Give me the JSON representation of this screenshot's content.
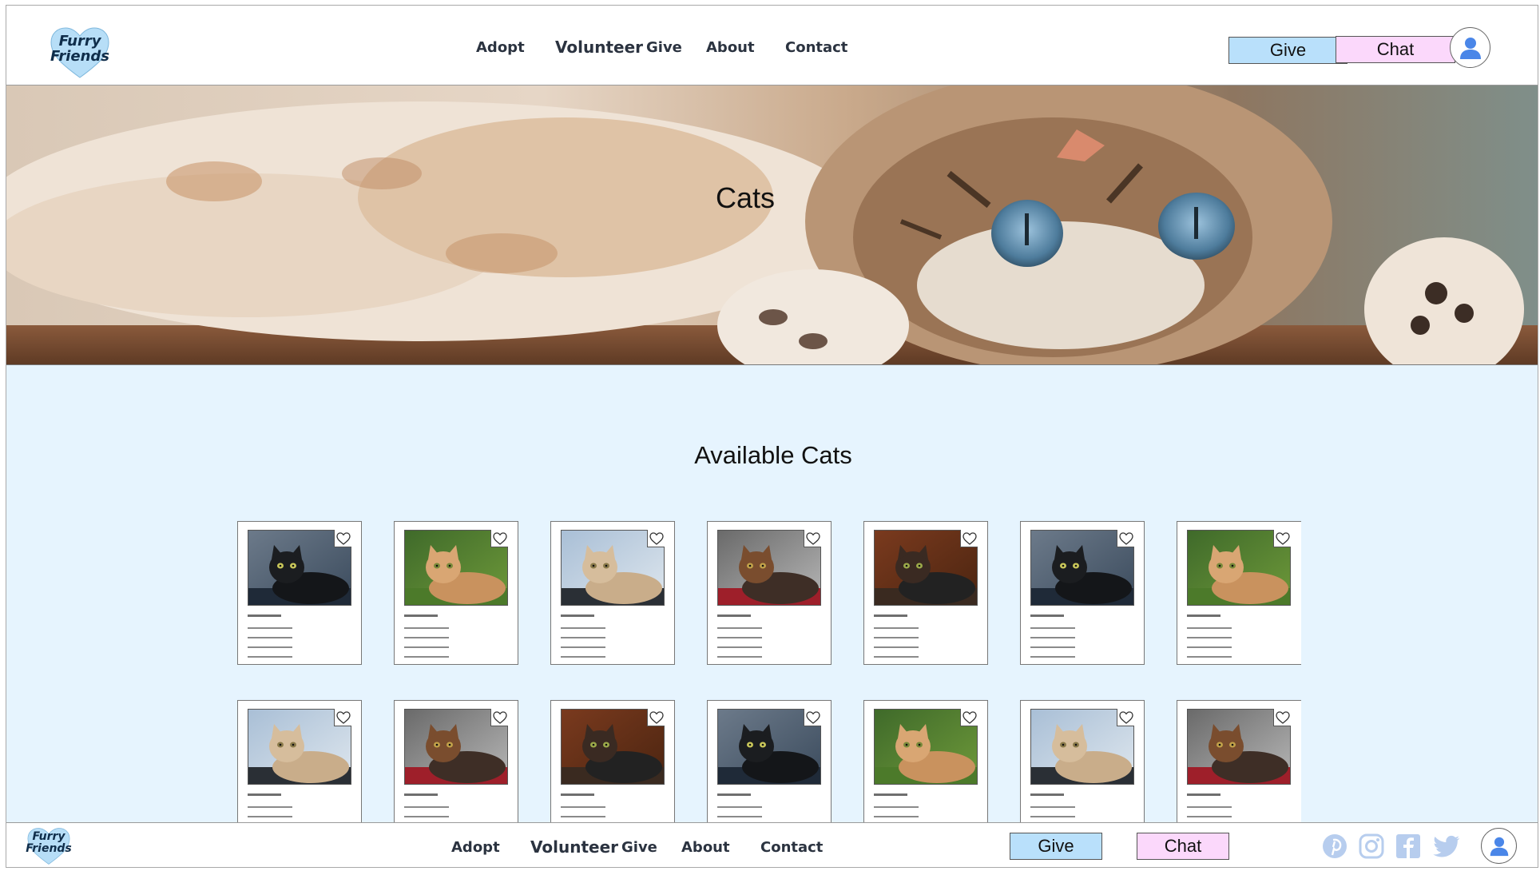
{
  "header": {
    "logo_line1": "Furry",
    "logo_line2": "Friends",
    "nav": [
      "Adopt",
      "Volunteer",
      "Give",
      "About",
      "Contact"
    ],
    "give_label": "Give",
    "chat_label": "Chat",
    "avatar_icon": "user-icon"
  },
  "hero": {
    "title": "Cats",
    "image": "cat-lying-upside-down-photo"
  },
  "main": {
    "section_title": "Available Cats",
    "cards_row1": [
      {
        "cat": "black",
        "favorite_icon": "heart-outline-icon"
      },
      {
        "cat": "ginger",
        "favorite_icon": "heart-outline-icon"
      },
      {
        "cat": "cream-outdoor",
        "favorite_icon": "heart-outline-icon"
      },
      {
        "cat": "tortoiseshell",
        "favorite_icon": "heart-outline-icon"
      },
      {
        "cat": "calico-dark",
        "favorite_icon": "heart-outline-icon"
      },
      {
        "cat": "black",
        "favorite_icon": "heart-outline-icon"
      },
      {
        "cat": "ginger",
        "favorite_icon": "heart-outline-icon"
      }
    ],
    "cards_row2": [
      {
        "cat": "cream-outdoor",
        "favorite_icon": "heart-outline-icon"
      },
      {
        "cat": "tortoiseshell",
        "favorite_icon": "heart-outline-icon"
      },
      {
        "cat": "calico-dark",
        "favorite_icon": "heart-outline-icon"
      },
      {
        "cat": "black",
        "favorite_icon": "heart-outline-icon"
      },
      {
        "cat": "ginger",
        "favorite_icon": "heart-outline-icon"
      },
      {
        "cat": "cream-outdoor",
        "favorite_icon": "heart-outline-icon"
      },
      {
        "cat": "tortoiseshell",
        "favorite_icon": "heart-outline-icon"
      }
    ]
  },
  "footer": {
    "logo_line1": "Furry",
    "logo_line2": "Friends",
    "nav": [
      "Adopt",
      "Volunteer",
      "Give",
      "About",
      "Contact"
    ],
    "give_label": "Give",
    "chat_label": "Chat",
    "social_icons": [
      "pinterest-icon",
      "instagram-icon",
      "facebook-icon",
      "twitter-icon"
    ],
    "avatar_icon": "user-icon"
  },
  "colors": {
    "main_bg": "#e6f4fe",
    "give_bg": "#b9e0fb",
    "chat_bg": "#fbd8fb",
    "accent_blue": "#4a86e8",
    "logo_heart": "#b7def7"
  }
}
